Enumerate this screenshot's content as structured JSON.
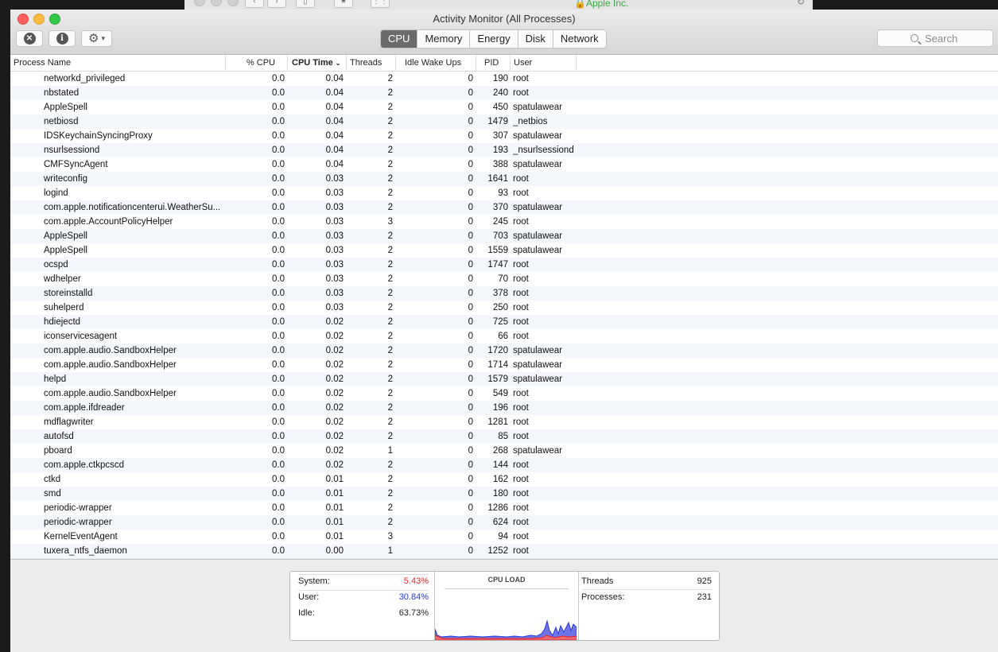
{
  "background_browser": {
    "url_text": "Apple Inc.",
    "accent_color": "#3aa845"
  },
  "window": {
    "title": "Activity Monitor (All Processes)"
  },
  "toolbar": {
    "stop_icon": "x-circle-icon",
    "info_icon": "info-icon",
    "action_icon": "gear-icon",
    "tabs": [
      "CPU",
      "Memory",
      "Energy",
      "Disk",
      "Network"
    ],
    "active_tab": "CPU",
    "search_placeholder": "Search"
  },
  "table": {
    "columns": [
      "Process Name",
      "% CPU",
      "CPU Time",
      "Threads",
      "Idle Wake Ups",
      "PID",
      "User"
    ],
    "sorted_column": "CPU Time",
    "rows": [
      {
        "name": "networkd_privileged",
        "cpu": "0.0",
        "time": "0.04",
        "threads": "2",
        "idle": "0",
        "pid": "190",
        "user": "root"
      },
      {
        "name": "nbstated",
        "cpu": "0.0",
        "time": "0.04",
        "threads": "2",
        "idle": "0",
        "pid": "240",
        "user": "root"
      },
      {
        "name": "AppleSpell",
        "cpu": "0.0",
        "time": "0.04",
        "threads": "2",
        "idle": "0",
        "pid": "450",
        "user": "spatulawear"
      },
      {
        "name": "netbiosd",
        "cpu": "0.0",
        "time": "0.04",
        "threads": "2",
        "idle": "0",
        "pid": "1479",
        "user": "_netbios"
      },
      {
        "name": "IDSKeychainSyncingProxy",
        "cpu": "0.0",
        "time": "0.04",
        "threads": "2",
        "idle": "0",
        "pid": "307",
        "user": "spatulawear"
      },
      {
        "name": "nsurlsessiond",
        "cpu": "0.0",
        "time": "0.04",
        "threads": "2",
        "idle": "0",
        "pid": "193",
        "user": "_nsurlsessiond"
      },
      {
        "name": "CMFSyncAgent",
        "cpu": "0.0",
        "time": "0.04",
        "threads": "2",
        "idle": "0",
        "pid": "388",
        "user": "spatulawear"
      },
      {
        "name": "writeconfig",
        "cpu": "0.0",
        "time": "0.03",
        "threads": "2",
        "idle": "0",
        "pid": "1641",
        "user": "root"
      },
      {
        "name": "logind",
        "cpu": "0.0",
        "time": "0.03",
        "threads": "2",
        "idle": "0",
        "pid": "93",
        "user": "root"
      },
      {
        "name": "com.apple.notificationcenterui.WeatherSu...",
        "cpu": "0.0",
        "time": "0.03",
        "threads": "2",
        "idle": "0",
        "pid": "370",
        "user": "spatulawear"
      },
      {
        "name": "com.apple.AccountPolicyHelper",
        "cpu": "0.0",
        "time": "0.03",
        "threads": "3",
        "idle": "0",
        "pid": "245",
        "user": "root"
      },
      {
        "name": "AppleSpell",
        "cpu": "0.0",
        "time": "0.03",
        "threads": "2",
        "idle": "0",
        "pid": "703",
        "user": "spatulawear"
      },
      {
        "name": "AppleSpell",
        "cpu": "0.0",
        "time": "0.03",
        "threads": "2",
        "idle": "0",
        "pid": "1559",
        "user": "spatulawear"
      },
      {
        "name": "ocspd",
        "cpu": "0.0",
        "time": "0.03",
        "threads": "2",
        "idle": "0",
        "pid": "1747",
        "user": "root"
      },
      {
        "name": "wdhelper",
        "cpu": "0.0",
        "time": "0.03",
        "threads": "2",
        "idle": "0",
        "pid": "70",
        "user": "root"
      },
      {
        "name": "storeinstalld",
        "cpu": "0.0",
        "time": "0.03",
        "threads": "2",
        "idle": "0",
        "pid": "378",
        "user": "root"
      },
      {
        "name": "suhelperd",
        "cpu": "0.0",
        "time": "0.03",
        "threads": "2",
        "idle": "0",
        "pid": "250",
        "user": "root"
      },
      {
        "name": "hdiejectd",
        "cpu": "0.0",
        "time": "0.02",
        "threads": "2",
        "idle": "0",
        "pid": "725",
        "user": "root"
      },
      {
        "name": "iconservicesagent",
        "cpu": "0.0",
        "time": "0.02",
        "threads": "2",
        "idle": "0",
        "pid": "66",
        "user": "root"
      },
      {
        "name": "com.apple.audio.SandboxHelper",
        "cpu": "0.0",
        "time": "0.02",
        "threads": "2",
        "idle": "0",
        "pid": "1720",
        "user": "spatulawear"
      },
      {
        "name": "com.apple.audio.SandboxHelper",
        "cpu": "0.0",
        "time": "0.02",
        "threads": "2",
        "idle": "0",
        "pid": "1714",
        "user": "spatulawear"
      },
      {
        "name": "helpd",
        "cpu": "0.0",
        "time": "0.02",
        "threads": "2",
        "idle": "0",
        "pid": "1579",
        "user": "spatulawear"
      },
      {
        "name": "com.apple.audio.SandboxHelper",
        "cpu": "0.0",
        "time": "0.02",
        "threads": "2",
        "idle": "0",
        "pid": "549",
        "user": "root"
      },
      {
        "name": "com.apple.ifdreader",
        "cpu": "0.0",
        "time": "0.02",
        "threads": "2",
        "idle": "0",
        "pid": "196",
        "user": "root"
      },
      {
        "name": "mdflagwriter",
        "cpu": "0.0",
        "time": "0.02",
        "threads": "2",
        "idle": "0",
        "pid": "1281",
        "user": "root"
      },
      {
        "name": "autofsd",
        "cpu": "0.0",
        "time": "0.02",
        "threads": "2",
        "idle": "0",
        "pid": "85",
        "user": "root"
      },
      {
        "name": "pboard",
        "cpu": "0.0",
        "time": "0.02",
        "threads": "1",
        "idle": "0",
        "pid": "268",
        "user": "spatulawear"
      },
      {
        "name": "com.apple.ctkpcscd",
        "cpu": "0.0",
        "time": "0.02",
        "threads": "2",
        "idle": "0",
        "pid": "144",
        "user": "root"
      },
      {
        "name": "ctkd",
        "cpu": "0.0",
        "time": "0.01",
        "threads": "2",
        "idle": "0",
        "pid": "162",
        "user": "root"
      },
      {
        "name": "smd",
        "cpu": "0.0",
        "time": "0.01",
        "threads": "2",
        "idle": "0",
        "pid": "180",
        "user": "root"
      },
      {
        "name": "periodic-wrapper",
        "cpu": "0.0",
        "time": "0.01",
        "threads": "2",
        "idle": "0",
        "pid": "1286",
        "user": "root"
      },
      {
        "name": "periodic-wrapper",
        "cpu": "0.0",
        "time": "0.01",
        "threads": "2",
        "idle": "0",
        "pid": "624",
        "user": "root"
      },
      {
        "name": "KernelEventAgent",
        "cpu": "0.0",
        "time": "0.01",
        "threads": "3",
        "idle": "0",
        "pid": "94",
        "user": "root"
      },
      {
        "name": "tuxera_ntfs_daemon",
        "cpu": "0.0",
        "time": "0.00",
        "threads": "1",
        "idle": "0",
        "pid": "1252",
        "user": "root"
      }
    ]
  },
  "footer": {
    "system_label": "System:",
    "system_value": "5.43%",
    "system_color": "#e0262b",
    "user_label": "User:",
    "user_value": "30.84%",
    "user_color": "#2a3bd6",
    "idle_label": "Idle:",
    "idle_value": "63.73%",
    "cpu_load_title": "CPU LOAD",
    "threads_label": "Threads",
    "threads_value": "925",
    "processes_label": "Processes:",
    "processes_value": "231"
  }
}
